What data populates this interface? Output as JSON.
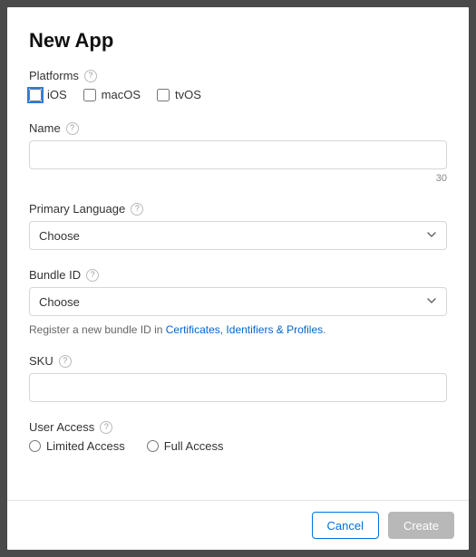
{
  "title": "New App",
  "platforms": {
    "label": "Platforms",
    "options": [
      {
        "label": "iOS",
        "checked": false,
        "focused": true
      },
      {
        "label": "macOS",
        "checked": false,
        "focused": false
      },
      {
        "label": "tvOS",
        "checked": false,
        "focused": false
      }
    ]
  },
  "name": {
    "label": "Name",
    "value": "",
    "counter": "30"
  },
  "primaryLanguage": {
    "label": "Primary Language",
    "selected": "Choose"
  },
  "bundleId": {
    "label": "Bundle ID",
    "selected": "Choose",
    "hintPrefix": "Register a new bundle ID in ",
    "hintLink": "Certificates, Identifiers & Profiles",
    "hintSuffix": "."
  },
  "sku": {
    "label": "SKU",
    "value": ""
  },
  "userAccess": {
    "label": "User Access",
    "options": [
      {
        "label": "Limited Access",
        "checked": false
      },
      {
        "label": "Full Access",
        "checked": false
      }
    ]
  },
  "footer": {
    "cancel": "Cancel",
    "create": "Create"
  }
}
